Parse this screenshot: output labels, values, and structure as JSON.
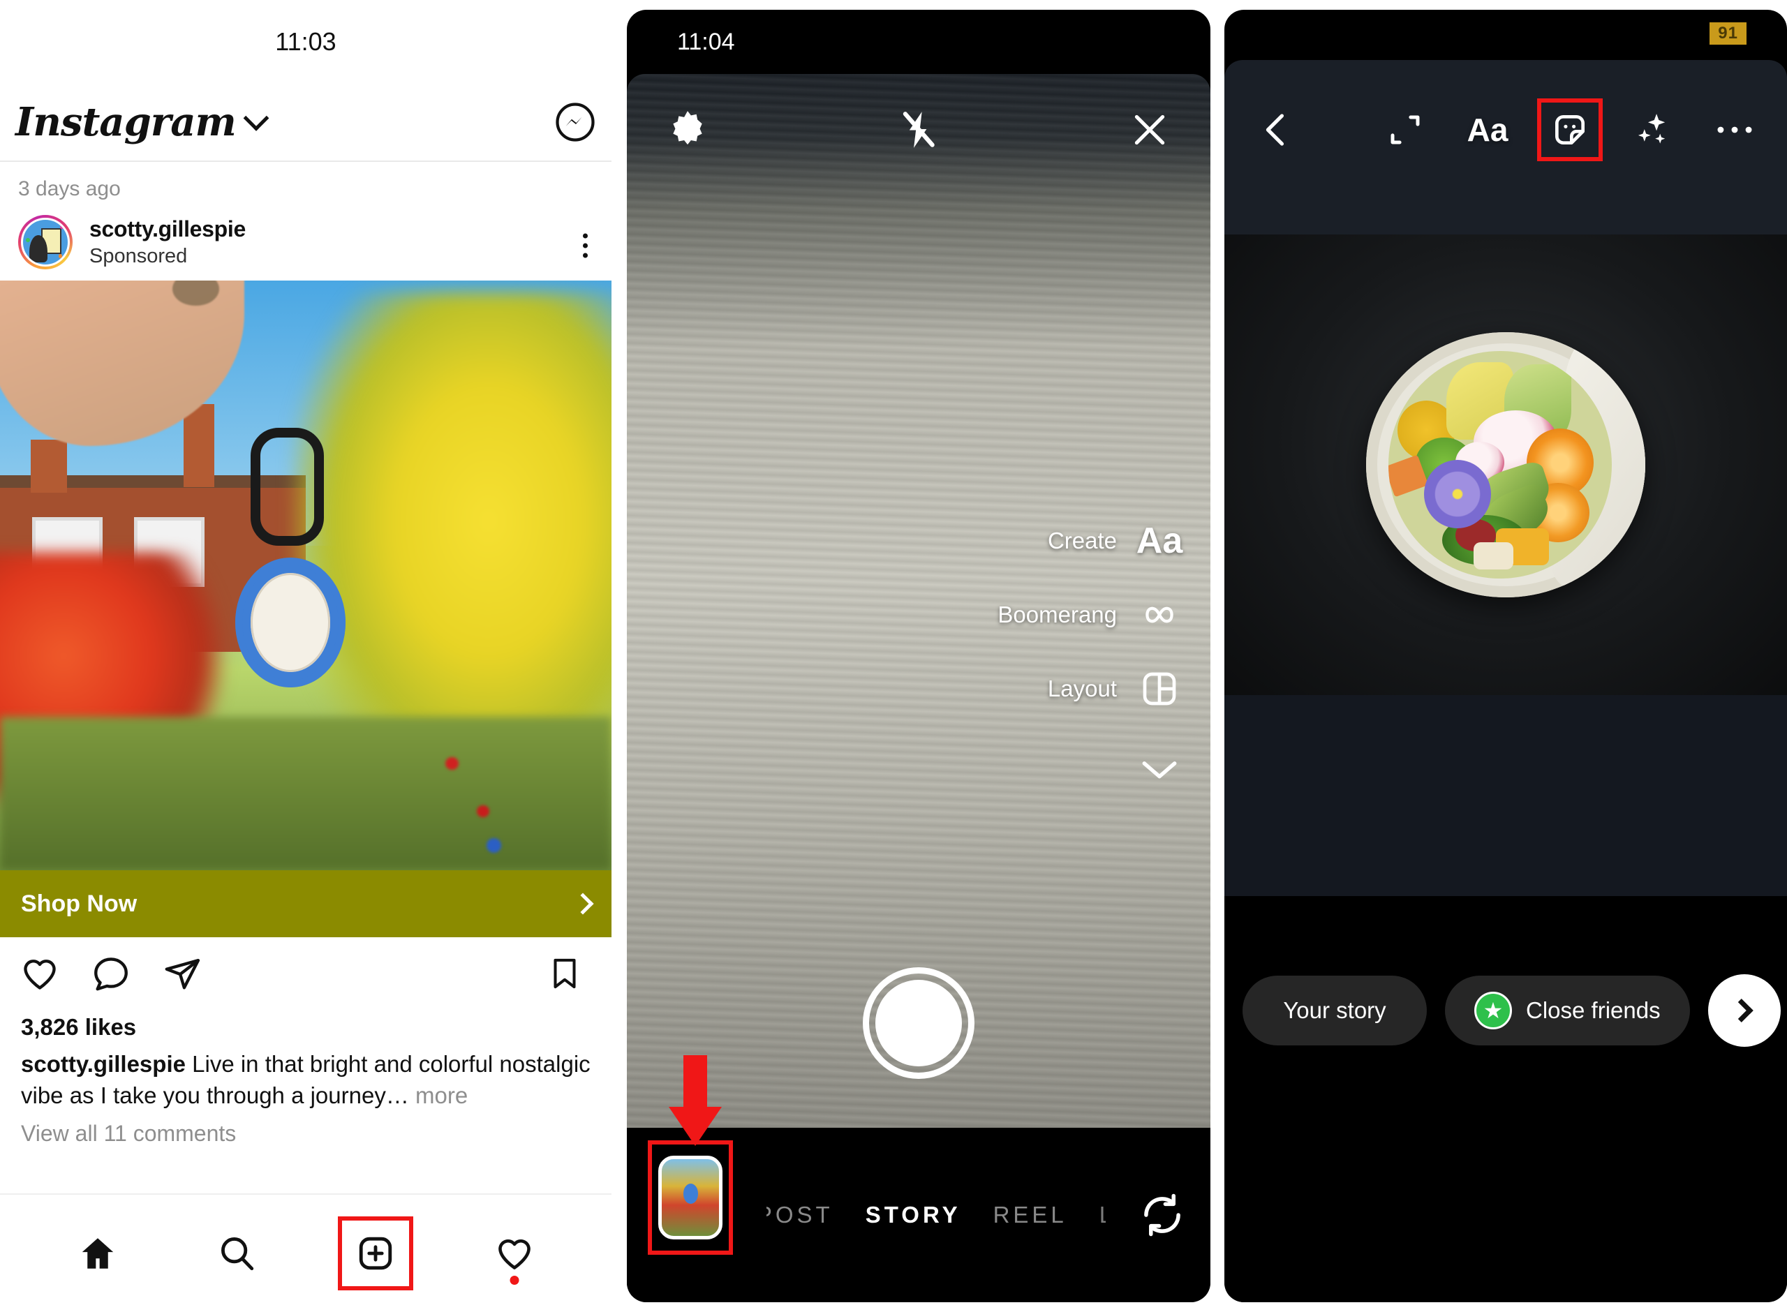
{
  "feed": {
    "status_time": "11:03",
    "app_title": "Instagram",
    "chevron_icon": "chevron-down-icon",
    "messenger_icon": "messenger-icon",
    "timestamp": "3 days ago",
    "post": {
      "username": "scotty.gillespie",
      "subtitle": "Sponsored",
      "avatar_icon": "avatar",
      "menu_icon": "kebab-menu-icon",
      "photo_alt": "Hand holding a blue CASETiFY AirTag keyring in front of an autumn garden and brick house",
      "cta_label": "Shop Now",
      "cta_chevron_icon": "chevron-right-icon",
      "cta_color": "#8b8b00",
      "like_icon": "heart-icon",
      "comment_icon": "comment-icon",
      "share_icon": "share-icon",
      "save_icon": "bookmark-icon",
      "likes": "3,826 likes",
      "caption_user": "scotty.gillespie",
      "caption_text": " Live in that bright and colorful nostalgic vibe as I take you through a journey… ",
      "caption_more": "more",
      "view_comments": "View all 11 comments"
    },
    "tabbar": {
      "home_icon": "home-icon",
      "search_icon": "search-icon",
      "create_icon": "create-plus-icon",
      "activity_icon": "heart-activity-icon",
      "highlight_color": "#f01717"
    }
  },
  "camera": {
    "status_time": "11:04",
    "settings_icon": "gear-icon",
    "flash_icon": "flash-off-icon",
    "close_icon": "close-icon",
    "menu": [
      {
        "label": "Create",
        "icon": "text-aa-icon"
      },
      {
        "label": "Boomerang",
        "icon": "infinity-icon"
      },
      {
        "label": "Layout",
        "icon": "layout-grid-icon"
      }
    ],
    "expand_icon": "chevron-down-icon",
    "shutter_icon": "shutter-button",
    "gallery_thumb_icon": "gallery-thumbnail",
    "arrow_icon": "red-arrow-down",
    "highlight_color": "#f01717",
    "modes": [
      {
        "label": "POST",
        "active": false
      },
      {
        "label": "STORY",
        "active": true
      },
      {
        "label": "REEL",
        "active": false
      },
      {
        "label": "L",
        "active": false
      }
    ],
    "flip_icon": "flip-camera-icon"
  },
  "story_editor": {
    "battery_badge": "91",
    "back_icon": "back-chevron-icon",
    "tools": [
      {
        "icon": "crop-expand-icon",
        "name": "crop"
      },
      {
        "icon": "text-aa-icon",
        "name": "text"
      },
      {
        "icon": "sticker-icon",
        "name": "sticker",
        "highlighted": true
      },
      {
        "icon": "sparkles-icon",
        "name": "effects"
      },
      {
        "icon": "more-dots-icon",
        "name": "more"
      }
    ],
    "highlight_color": "#f01717",
    "photo_alt": "Overhead salad bowl with avocado, orange slices, radish, edamame and a purple pansy flower",
    "your_story_label": "Your story",
    "close_friends_label": "Close friends",
    "close_friends_star_icon": "star-icon",
    "close_friends_color": "#2ec04b",
    "next_icon": "chevron-right-icon"
  }
}
